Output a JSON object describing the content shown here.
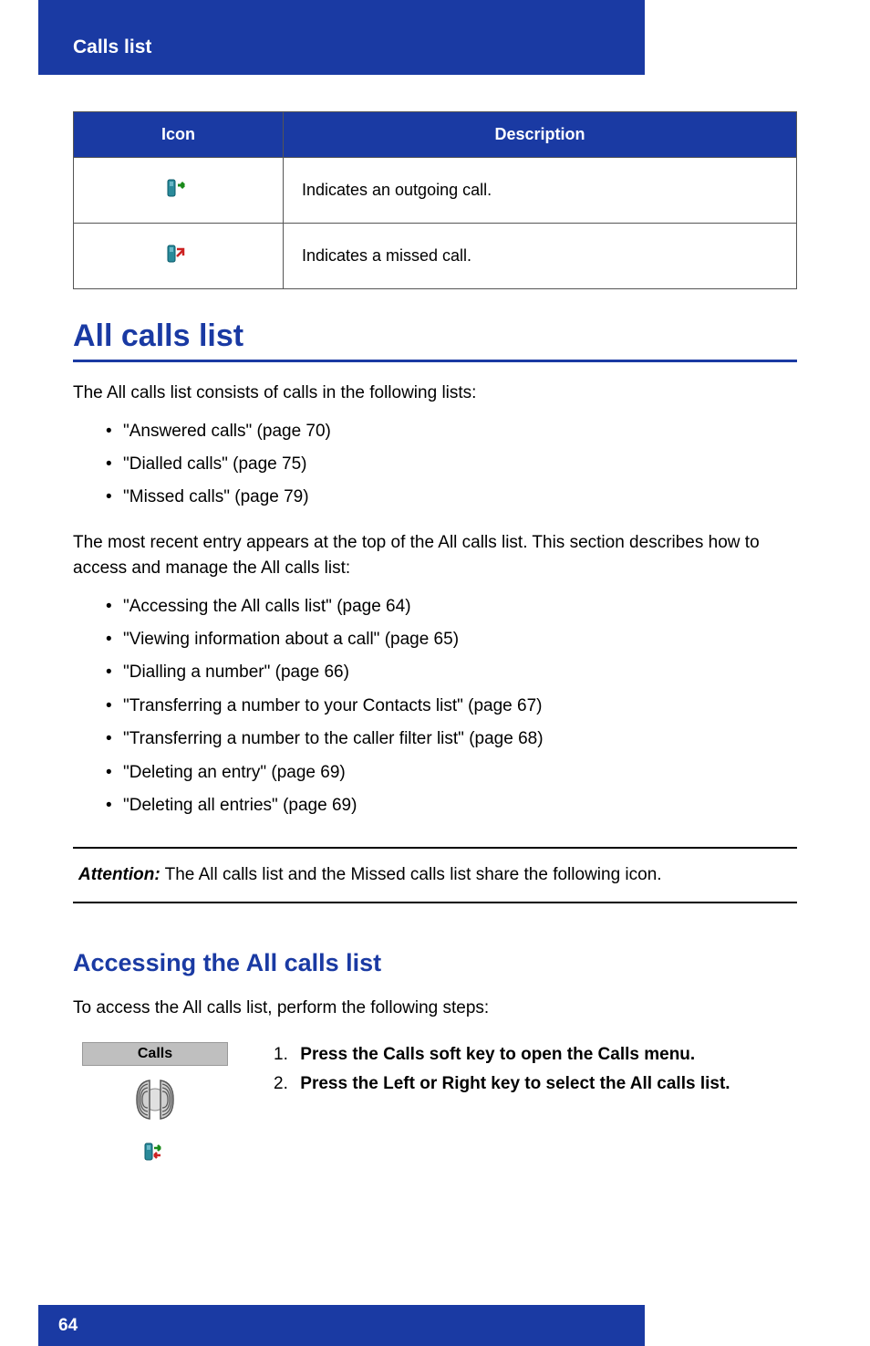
{
  "header": {
    "title": "Calls list"
  },
  "table": {
    "head_icon": "Icon",
    "head_desc": "Description",
    "row1_desc": "Indicates an outgoing call.",
    "row2_desc": "Indicates a missed call."
  },
  "sections": {
    "all_calls": {
      "heading": "All calls list",
      "p1": "The All calls list consists of calls in the following lists:",
      "bullets": {
        "b1": "\"Answered calls\" (page 70)",
        "b2": "\"Dialled calls\" (page 75)",
        "b3": "\"Missed calls\" (page 79)"
      },
      "p2a": "The most recent entry appears at the top of the All calls list. This section describes how to access and manage the All calls list:",
      "bullets2": {
        "b1": "\"Accessing the All calls list\" (page 64)",
        "b2": "\"Viewing information about a call\" (page 65)",
        "b3": "\"Dialling a number\" (page 66)",
        "b4": "\"Transferring a number to your Contacts list\" (page 67)",
        "b5": "\"Transferring a number to the caller filter list\" (page 68)",
        "b6": "\"Deleting an entry\" (page 69)",
        "b7": "\"Deleting all entries\" (page 69)"
      },
      "attention_label": "Attention:",
      "attention_text": " The All calls list and the Missed calls list share the following icon."
    },
    "accessing": {
      "heading": "Accessing the All calls list",
      "intro": "To access the All calls list, perform the following steps:",
      "step1": {
        "num": "1.",
        "text": "Press the Calls soft key to open the Calls menu."
      },
      "step2": {
        "num": "2.",
        "text": "Press the Left or Right key to select the All calls list."
      },
      "calls_key_label": "Calls"
    }
  },
  "footer": {
    "page": "64"
  }
}
